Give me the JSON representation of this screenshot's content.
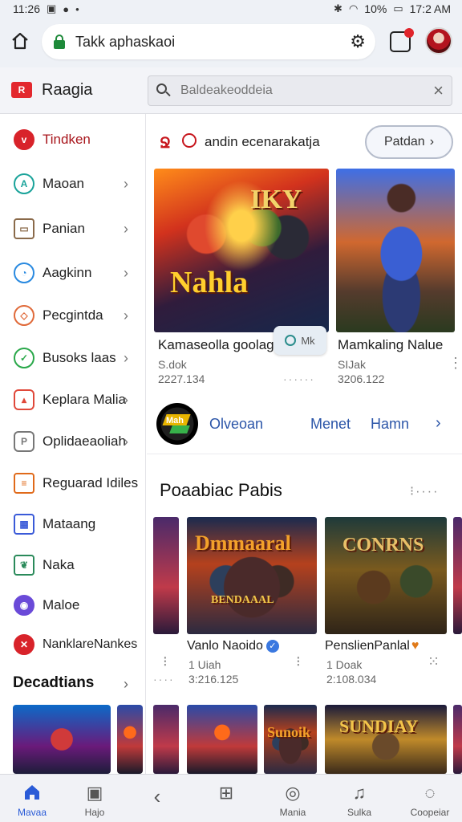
{
  "status": {
    "time": "11:26",
    "battery": "10%",
    "clock_right": "17:2 AM"
  },
  "browser": {
    "url": "Takk aphaskaoi"
  },
  "header": {
    "brand": "Raagia",
    "search_placeholder": "Baldeakeoddeia"
  },
  "sidebar": {
    "items": [
      {
        "label": "Tindken",
        "icon": "v-badge-icon",
        "color": "#d8232a"
      },
      {
        "label": "Maoan",
        "icon": "shopping-bag-icon",
        "color": "#1aa39a"
      },
      {
        "label": "Panian",
        "icon": "box-icon",
        "color": "#8a6a4a"
      },
      {
        "label": "Aagkinn",
        "icon": "compass-icon",
        "color": "#2a8ae0"
      },
      {
        "label": "Pecgintda",
        "icon": "tag-icon",
        "color": "#e06a3a"
      },
      {
        "label": "Busoks laas",
        "icon": "check-circle-icon",
        "color": "#2aa84a"
      },
      {
        "label": "Keplara Malia",
        "icon": "chart-icon",
        "color": "#e0483a"
      },
      {
        "label": "Oplidaeaoliah",
        "icon": "puzzle-icon",
        "color": "#777777"
      },
      {
        "label": "Reguarad Idiles",
        "icon": "document-icon",
        "color": "#e06a1a"
      },
      {
        "label": "Mataang",
        "icon": "grid-icon",
        "color": "#3a5ad8"
      },
      {
        "label": "Naka",
        "icon": "leaf-icon",
        "color": "#2a8a5a"
      },
      {
        "label": "Maloe",
        "icon": "gamepad-icon",
        "color": "#6a4ad8"
      },
      {
        "label": "NanklareNankes",
        "icon": "x-logo-icon",
        "color": "#d8232a"
      }
    ],
    "section_heading": "Decadtians"
  },
  "featured": {
    "heading": "andin ecenarakatja",
    "button": "Patdan",
    "cards": [
      {
        "title": "Kamaseolla goolag",
        "meta1": "S.dok",
        "meta2": "2227.134",
        "art_text": "Nahla",
        "art_text2": "IKY"
      },
      {
        "title": "Mamkaling Nalue",
        "meta1": "SIJak",
        "meta2": "3206.122"
      }
    ],
    "chip": "Mk"
  },
  "channel": {
    "logo_text": "Mah",
    "links": [
      "Olveoan",
      "Menet",
      "Hamn"
    ]
  },
  "section2": {
    "title": "Poaabiac Pabis",
    "cards": [
      {
        "title": "Vanlo Naoido",
        "meta1": "1 Uiah",
        "meta2": "3:216.125",
        "art_text": "Dmmaaral",
        "art_sub": "BENDAAAL"
      },
      {
        "title": "PenslienPanlal",
        "meta1": "1 Doak",
        "meta2": "2:108.034",
        "art_text": "CONRNS"
      }
    ],
    "row3": [
      {
        "art_text": "Sunoik"
      },
      {
        "art_text": "SUNDIAY"
      }
    ]
  },
  "bottom_nav": [
    {
      "label": "Mavaa",
      "icon": "home-icon",
      "active": true
    },
    {
      "label": "Hajo",
      "icon": "image-icon",
      "active": false
    },
    {
      "label": "",
      "icon": "back-icon",
      "active": false
    },
    {
      "label": "",
      "icon": "grid-icon",
      "active": false
    },
    {
      "label": "Mania",
      "icon": "chat-icon",
      "active": false
    },
    {
      "label": "Sulka",
      "icon": "headset-icon",
      "active": false
    },
    {
      "label": "Coopeiar",
      "icon": "compass-icon",
      "active": false
    }
  ]
}
